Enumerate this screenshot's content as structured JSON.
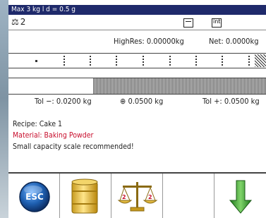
{
  "infobar": {
    "capacity": "Max 3 kg l d = 0.5 g"
  },
  "scale": {
    "number": "2"
  },
  "weights": {
    "high_res": "HighRes: 0.00000kg",
    "net": "Net: 0.0000kg"
  },
  "tolerance": {
    "minus": "Tol −: 0.0200 kg",
    "target": "0.0500 kg",
    "plus": "Tol +: 0.0500 kg"
  },
  "messages": {
    "recipe": "Recipe: Cake 1",
    "material": "Material: Baking Powder",
    "warning": "Small capacity scale recommended!"
  },
  "softkeys": {
    "esc": "ESC",
    "keys": [
      "esc-icon",
      "ingredient-container-icon",
      "balance-scale-icon",
      "empty",
      "arrow-down-icon"
    ]
  },
  "colors": {
    "header_bg": "#1f2a6b",
    "material_text": "#c8102e",
    "esc_blue": "#1e5fb0",
    "arrow_green": "#3a9a32"
  }
}
